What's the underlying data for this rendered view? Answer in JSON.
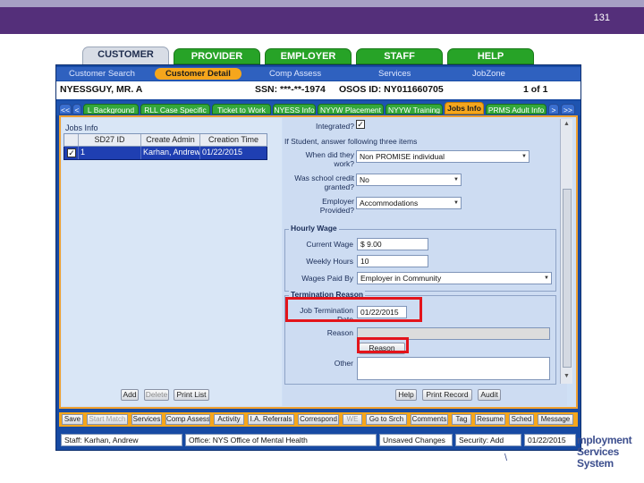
{
  "slide": {
    "number": "131"
  },
  "main_tabs": [
    "CUSTOMER",
    "PROVIDER",
    "EMPLOYER",
    "STAFF",
    "HELP"
  ],
  "sub_nav": [
    "Customer Search",
    "Customer Detail",
    "Comp Assess",
    "Services",
    "JobZone"
  ],
  "customer": {
    "name": "NYESSGUY, MR. A",
    "ssn": "SSN: ***-**-1974",
    "osos_id": "OSOS ID: NY011660705",
    "page": "1 of 1"
  },
  "sub_tabs": {
    "nav_left": [
      "<<",
      "<"
    ],
    "items": [
      "L Background",
      "RLL Case Specific",
      "Ticket to Work",
      "NYESS Info",
      "NYYW Placement",
      "NYYW Training",
      "Jobs Info",
      "PRMS Adult Info"
    ],
    "nav_right": [
      ">",
      ">>"
    ],
    "active": "Jobs Info"
  },
  "jobs_info": {
    "title": "Jobs Info",
    "columns": [
      "SD27 ID",
      "Create Admin",
      "Creation Time"
    ],
    "rows": [
      {
        "checked": "✓",
        "id": "1",
        "admin": "Karhan, Andrew",
        "time": "01/22/2015"
      }
    ],
    "buttons": [
      "Add",
      "Delete",
      "Print List"
    ]
  },
  "form": {
    "integrated_label": "Integrated?",
    "integrated_checked": "✓",
    "student_note": "If Student, answer following three items",
    "when_work_label": "When did they work?",
    "when_work_value": "Non PROMISE individual",
    "school_credit_label": "Was school credit granted?",
    "school_credit_value": "No",
    "employer_provided_label": "Employer Provided?",
    "employer_provided_value": "Accommodations",
    "hourly_wage": {
      "title": "Hourly Wage",
      "current_wage_label": "Current Wage",
      "current_wage_value": "$ 9.00",
      "weekly_hours_label": "Weekly Hours",
      "weekly_hours_value": "10",
      "wages_paid_by_label": "Wages Paid By",
      "wages_paid_by_value": "Employer in Community"
    },
    "termination": {
      "title": "Termination Reason",
      "date_label": "Job Termination Date",
      "date_value": "01/22/2015",
      "reason_label": "Reason",
      "reason_value": "",
      "reason_button": "Reason",
      "other_label": "Other",
      "other_value": ""
    },
    "buttons": [
      "Help",
      "Print Record",
      "Audit"
    ]
  },
  "bottom_buttons": [
    "Save",
    "Start Match",
    "Services",
    "Comp Assess",
    "Activity",
    "I.A. Referrals",
    "Correspond",
    "WE",
    "Go to Srch",
    "Comments",
    "Tag",
    "Resume",
    "Sched",
    "Message"
  ],
  "status_bar": {
    "staff": "Staff: Karhan, Andrew",
    "office": "Office: NYS Office of Mental Health",
    "unsaved": "Unsaved Changes",
    "security": "Security: Add",
    "date": "01/22/2015"
  },
  "logo": {
    "line1": "mployment",
    "line2": "Services System",
    "mark": "\\"
  },
  "colors": {
    "slide_header": "#542f7a",
    "app_frame": "#174aa3",
    "active_tab": "#f5a61c",
    "green_tab": "#27a327",
    "highlight": "#e3141b"
  }
}
